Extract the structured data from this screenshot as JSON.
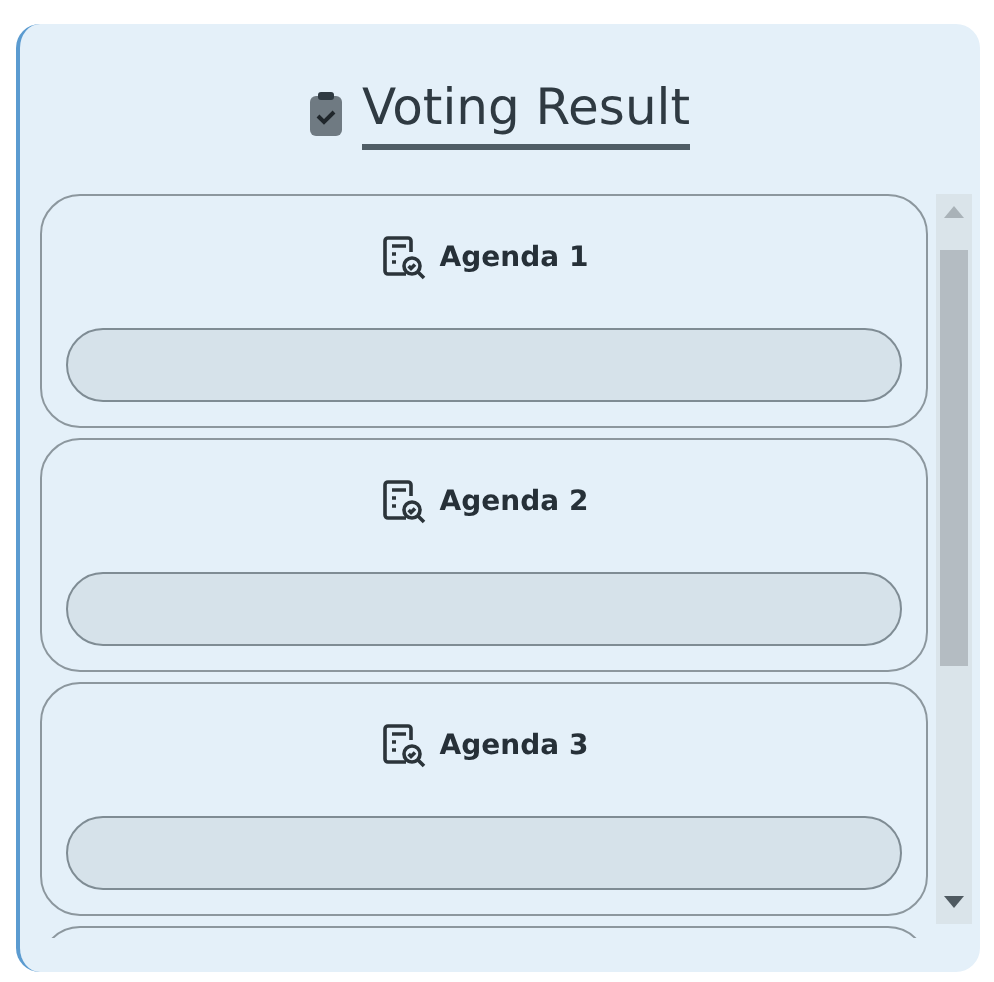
{
  "title": "Voting Result",
  "agendas": [
    {
      "kind": "agenda",
      "label": "Agenda 1",
      "level": 0
    },
    {
      "kind": "agenda",
      "label": "Agenda 2",
      "level": 0
    },
    {
      "kind": "agenda",
      "label": "Agenda 3",
      "level": 0
    },
    {
      "kind": "partial"
    }
  ]
}
